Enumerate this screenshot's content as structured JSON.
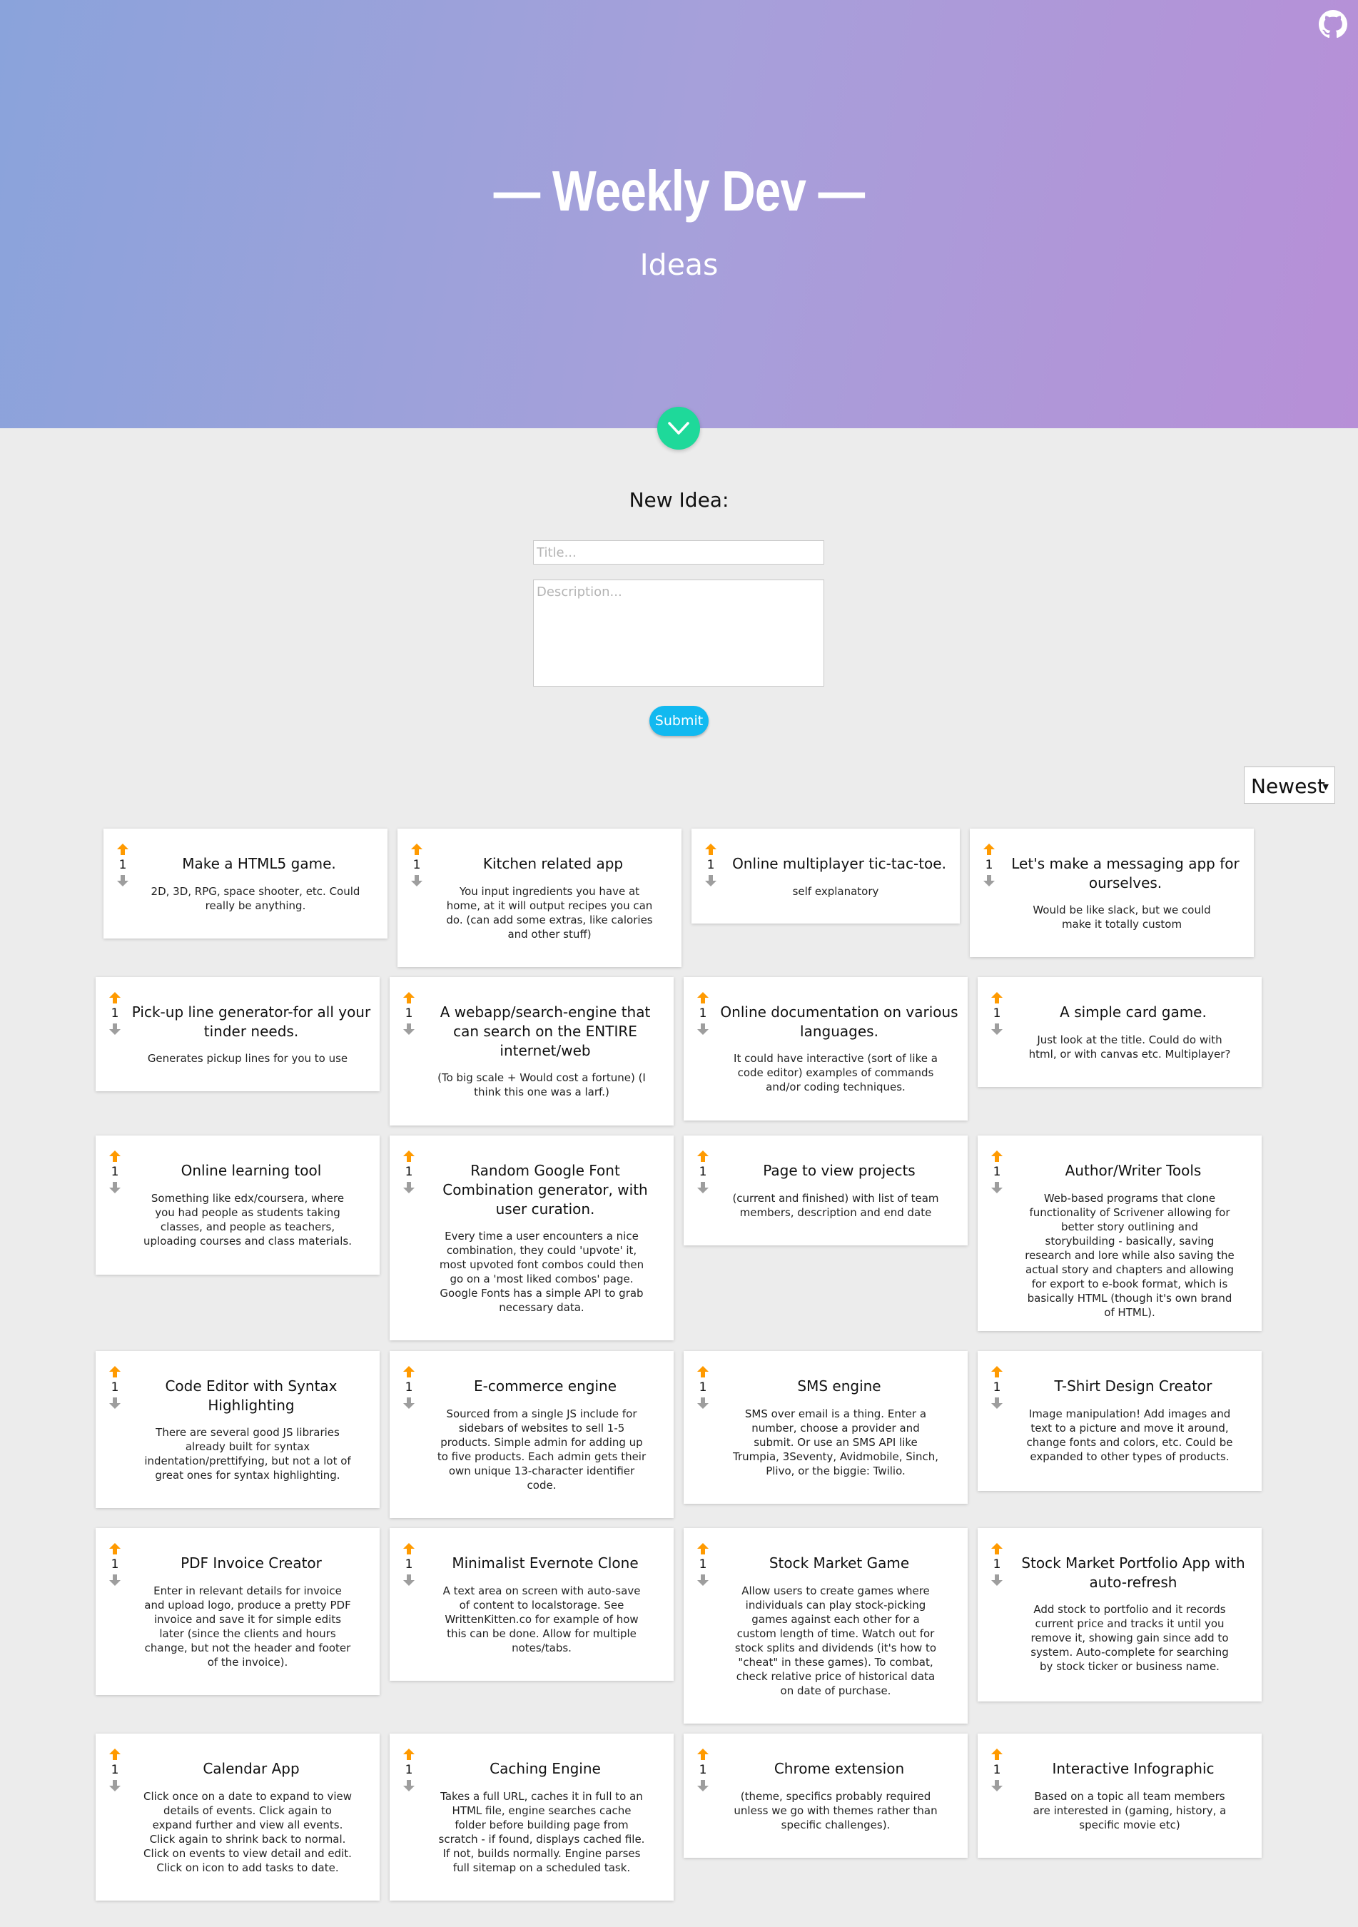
{
  "header": {
    "title": "— Weekly Dev —",
    "subtitle": "Ideas"
  },
  "icons": {
    "github": "github-icon",
    "scroll_down": "chevron-down-icon",
    "upvote": "arrow-up-icon",
    "downvote": "arrow-down-icon"
  },
  "colors": {
    "hero_start": "#8aa3db",
    "hero_end": "#b78fd7",
    "accent_green": "#1ed99a",
    "submit_blue": "#12b9f0",
    "upvote_orange": "#ff9a00",
    "downvote_gray": "#9e9e9e"
  },
  "form": {
    "heading": "New Idea:",
    "title_placeholder": "Title...",
    "description_placeholder": "Description...",
    "submit_label": "Submit"
  },
  "sort": {
    "selected": "Newest"
  },
  "ideas": [
    {
      "votes": "1",
      "title": "Make a HTML5 game.",
      "description": "2D, 3D, RPG, space shooter, etc. Could really be anything."
    },
    {
      "votes": "1",
      "title": "Kitchen related app",
      "description": "You input ingredients you have at home, at it will output recipes you can do. (can add some extras, like calories and other stuff)"
    },
    {
      "votes": "1",
      "title": "Online multiplayer tic-tac-toe.",
      "description": "self explanatory"
    },
    {
      "votes": "1",
      "title": "Let's make a messaging app for ourselves.",
      "description": "Would be like slack, but we could make it totally custom"
    },
    {
      "votes": "1",
      "title": "Pick-up line generator-for all your tinder needs.",
      "description": "Generates pickup lines for you to use"
    },
    {
      "votes": "1",
      "title": "A webapp/search-engine that can search on the ENTIRE internet/web",
      "description": "(To big scale + Would cost a fortune) (I think this one was a larf.)"
    },
    {
      "votes": "1",
      "title": "Online documentation on various languages.",
      "description": "It could have interactive (sort of like a code editor) examples of commands and/or coding techniques."
    },
    {
      "votes": "1",
      "title": "A simple card game.",
      "description": "Just look at the title. Could do with html, or with canvas etc. Multiplayer?"
    },
    {
      "votes": "1",
      "title": "Online learning tool",
      "description": "Something like edx/coursera, where you had people as students taking classes, and people as teachers, uploading courses and class materials."
    },
    {
      "votes": "1",
      "title": "Random Google Font Combination generator, with user curation.",
      "description": "Every time a user encounters a nice combination, they could 'upvote' it, most upvoted font combos could then go on a 'most liked combos' page. Google Fonts has a simple API to grab necessary data."
    },
    {
      "votes": "1",
      "title": "Page to view projects",
      "description": "(current and finished) with list of team members, description and end date"
    },
    {
      "votes": "1",
      "title": "Author/Writer Tools",
      "description": "Web-based programs that clone functionality of Scrivener allowing for better story outlining and storybuilding - basically, saving research and lore while also saving the actual story and chapters and allowing for export to e-book format, which is basically HTML (though it's own brand of HTML)."
    },
    {
      "votes": "1",
      "title": "Code Editor with Syntax Highlighting",
      "description": "There are several good JS libraries already built for syntax indentation/prettifying, but not a lot of great ones for syntax highlighting."
    },
    {
      "votes": "1",
      "title": "E-commerce engine",
      "description": "Sourced from a single JS include for sidebars of websites to sell 1-5 products. Simple admin for adding up to five products. Each admin gets their own unique 13-character identifier code."
    },
    {
      "votes": "1",
      "title": "SMS engine",
      "description": "SMS over email is a thing. Enter a number, choose a provider and submit. Or use an SMS API like Trumpia, 3Seventy, Avidmobile, Sinch, Plivo, or the biggie: Twilio."
    },
    {
      "votes": "1",
      "title": "T-Shirt Design Creator",
      "description": "Image manipulation! Add images and text to a picture and move it around, change fonts and colors, etc. Could be expanded to other types of products."
    },
    {
      "votes": "1",
      "title": "PDF Invoice Creator",
      "description": "Enter in relevant details for invoice and upload logo, produce a pretty PDF invoice and save it for simple edits later (since the clients and hours change, but not the header and footer of the invoice)."
    },
    {
      "votes": "1",
      "title": "Minimalist Evernote Clone",
      "description": "A text area on screen with auto-save of content to localstorage. See WrittenKitten.co for example of how this can be done. Allow for multiple notes/tabs."
    },
    {
      "votes": "1",
      "title": "Stock Market Game",
      "description": "Allow users to create games where individuals can play stock-picking games against each other for a custom length of time. Watch out for stock splits and dividends (it's how to \"cheat\" in these games). To combat, check relative price of historical data on date of purchase."
    },
    {
      "votes": "1",
      "title": "Stock Market Portfolio App with auto-refresh",
      "description": "Add stock to portfolio and it records current price and tracks it until you remove it, showing gain since add to system. Auto-complete for searching by stock ticker or business name."
    },
    {
      "votes": "1",
      "title": "Calendar App",
      "description": "Click once on a date to expand to view details of events. Click again to expand further and view all events. Click again to shrink back to normal. Click on events to view detail and edit. Click on icon to add tasks to date."
    },
    {
      "votes": "1",
      "title": "Caching Engine",
      "description": "Takes a full URL, caches it in full to an HTML file, engine searches cache folder before building page from scratch - if found, displays cached file. If not, builds normally. Engine parses full sitemap on a scheduled task."
    },
    {
      "votes": "1",
      "title": "Chrome extension",
      "description": "(theme, specifics probably required unless we go with themes rather than specific challenges)."
    },
    {
      "votes": "1",
      "title": "Interactive Infographic",
      "description": "Based on a topic all team members are interested in (gaming, history, a specific movie etc)"
    }
  ]
}
